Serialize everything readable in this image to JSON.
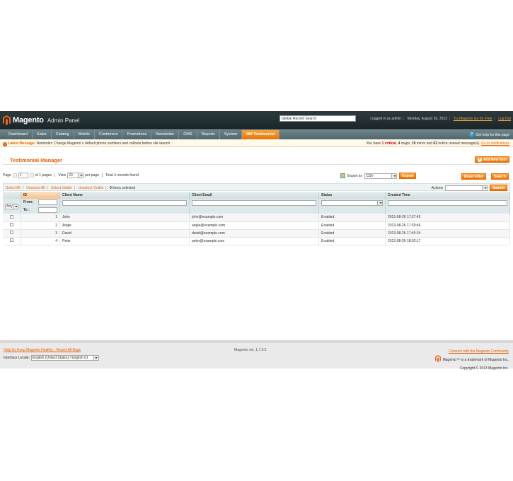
{
  "header": {
    "logo_text": "Magento",
    "logo_sub": "Admin Panel",
    "search_value": "Global Record Search",
    "logged_in": "Logged in as admin",
    "date": "Monday, August 26, 2013",
    "try_link": "Try Magento Go for Free",
    "logout": "Log Out"
  },
  "nav": {
    "items": [
      "Dashboard",
      "Sales",
      "Catalog",
      "Mobile",
      "Customers",
      "Promotions",
      "Newsletter",
      "CMS",
      "Reports",
      "System",
      "HM Testimonial"
    ],
    "help": "Get help for this page"
  },
  "notice": {
    "label": "Latest Message:",
    "text": "Reminder: Change Magento`s default phone numbers and callouts before site launch",
    "you_have": "You have",
    "critical_count": "1",
    "critical_label": "critical",
    "major_count": "4",
    "major_label": "major,",
    "minor_count": "19",
    "minor_label": "minor and",
    "notice_count": "63",
    "notice_label": "notice unread message(s).",
    "link": "Go to notifications"
  },
  "page": {
    "title": "Testimonial Manager",
    "add_button": "Add New Item"
  },
  "pager": {
    "page_label": "Page",
    "page_value": "1",
    "of_pages": "of 1 pages",
    "view_label": "View",
    "per_page_value": "20",
    "per_page_label": "per page",
    "total": "Total 4 records found",
    "export_label": "Export to:",
    "export_value": "CSV",
    "export_button": "Export",
    "reset_button": "Reset Filter",
    "search_button": "Search"
  },
  "massaction": {
    "select_all": "Select All",
    "unselect_all": "Unselect All",
    "select_visible": "Select Visible",
    "unselect_visible": "Unselect Visible",
    "selected_count": "0",
    "selected_label": "items selected",
    "actions_label": "Actions",
    "submit": "Submit"
  },
  "grid": {
    "columns": [
      "ID",
      "Client Name",
      "Client Email",
      "Status",
      "Created Time"
    ],
    "filter_any": "Any",
    "filter_from": "From:",
    "filter_to": "To :",
    "rows": [
      {
        "id": "1",
        "name": "John",
        "email": "john@example.com",
        "status": "Enabled",
        "created": "2013-08-26 17:27:42"
      },
      {
        "id": "2",
        "name": "Angle",
        "email": "angle@example.com",
        "status": "Enabled",
        "created": "2013-08-26 17:39:46"
      },
      {
        "id": "3",
        "name": "David",
        "email": "david@example.com",
        "status": "Enabled",
        "created": "2013-08-26 17:45:24"
      },
      {
        "id": "4",
        "name": "Peter",
        "email": "peter@example.com",
        "status": "Enabled",
        "created": "2013-08-26 18:02:17"
      }
    ]
  },
  "footer": {
    "help_link": "Help Us Keep Magento Healthy - Report All Bugs",
    "locale_label": "Interface Locale:",
    "locale_value": "English (United States) / English (U",
    "version": "Magento ver. 1.7.0.2",
    "community_link": "Connect with the Magento Community",
    "trademark": "Magento™ is a trademark of Magento Inc.",
    "copyright": "Copyright © 2013 Magento Inc."
  }
}
